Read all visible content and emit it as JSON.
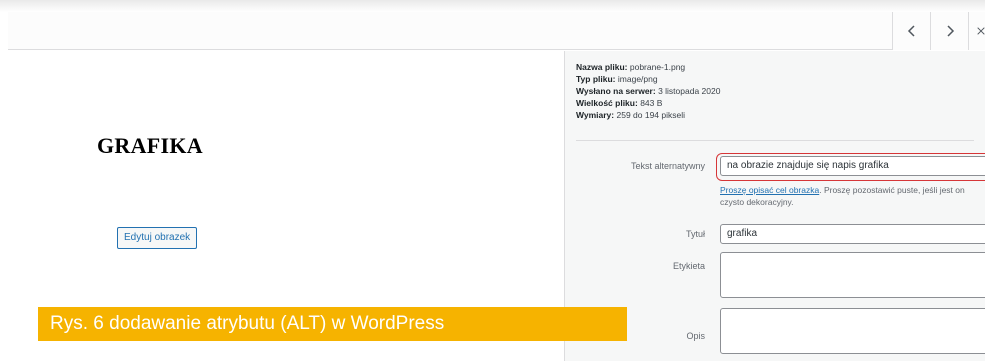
{
  "nav": {
    "prev_icon": "chevron-left-icon",
    "next_icon": "chevron-right-icon",
    "close_icon": "close-icon"
  },
  "preview": {
    "image_text": "GRAFIKA",
    "edit_button": "Edytuj obrazek"
  },
  "caption": "Rys. 6 dodawanie atrybutu (ALT) w WordPress",
  "details": {
    "file_name_label": "Nazwa pliku:",
    "file_name_value": "pobrane-1.png",
    "file_type_label": "Typ pliku:",
    "file_type_value": "image/png",
    "uploaded_label": "Wysłano na serwer:",
    "uploaded_value": "3 listopada 2020",
    "file_size_label": "Wielkość pliku:",
    "file_size_value": "843 B",
    "dimensions_label": "Wymiary:",
    "dimensions_value": "259 do 194 pikseli"
  },
  "form": {
    "alt_label": "Tekst alternatywny",
    "alt_value": "na obrazie znajduje się napis grafika",
    "help_link": "Proszę opisać cel obrazka",
    "help_text": ". Proszę pozostawić puste, jeśli jest on czysto dekoracyjny.",
    "title_label": "Tytuł",
    "title_value": "grafika",
    "caption_label": "Etykieta",
    "caption_value": "",
    "description_label": "Opis",
    "description_value": ""
  },
  "colors": {
    "accent": "#2271b1",
    "highlight": "#d63638",
    "caption_bg": "#f6b300"
  }
}
